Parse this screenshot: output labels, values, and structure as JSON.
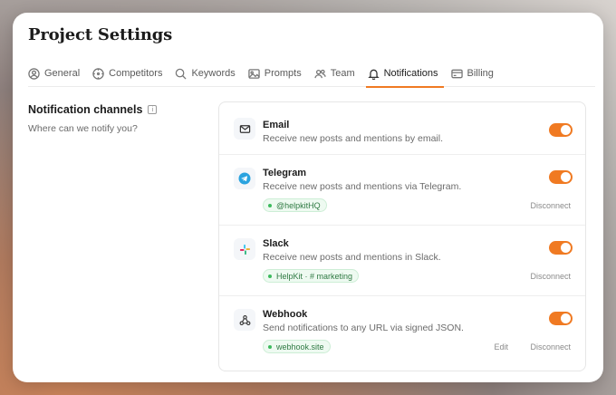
{
  "page": {
    "title": "Project Settings"
  },
  "tabs": [
    {
      "label": "General",
      "icon": "user-circle-icon",
      "active": false
    },
    {
      "label": "Competitors",
      "icon": "target-icon",
      "active": false
    },
    {
      "label": "Keywords",
      "icon": "search-icon",
      "active": false
    },
    {
      "label": "Prompts",
      "icon": "image-icon",
      "active": false
    },
    {
      "label": "Team",
      "icon": "users-icon",
      "active": false
    },
    {
      "label": "Notifications",
      "icon": "bell-icon",
      "active": true
    },
    {
      "label": "Billing",
      "icon": "credit-card-icon",
      "active": false
    }
  ],
  "section": {
    "title": "Notification channels",
    "subtitle": "Where can we notify you?"
  },
  "channels": [
    {
      "name": "Email",
      "description": "Receive new posts and mentions by email.",
      "icon": "mail-icon",
      "enabled": true
    },
    {
      "name": "Telegram",
      "description": "Receive new posts and mentions via Telegram.",
      "icon": "telegram-icon",
      "enabled": true,
      "connection": "@helpkitHQ",
      "disconnect_label": "Disconnect"
    },
    {
      "name": "Slack",
      "description": "Receive new posts and mentions in Slack.",
      "icon": "slack-icon",
      "enabled": true,
      "connection": "HelpKit · # marketing",
      "disconnect_label": "Disconnect"
    },
    {
      "name": "Webhook",
      "description": "Send notifications to any URL via signed JSON.",
      "icon": "webhook-icon",
      "enabled": true,
      "connection": "webhook.site",
      "edit_label": "Edit",
      "disconnect_label": "Disconnect"
    }
  ],
  "colors": {
    "accent": "#f07a22",
    "connected": "#3dbb5e"
  }
}
